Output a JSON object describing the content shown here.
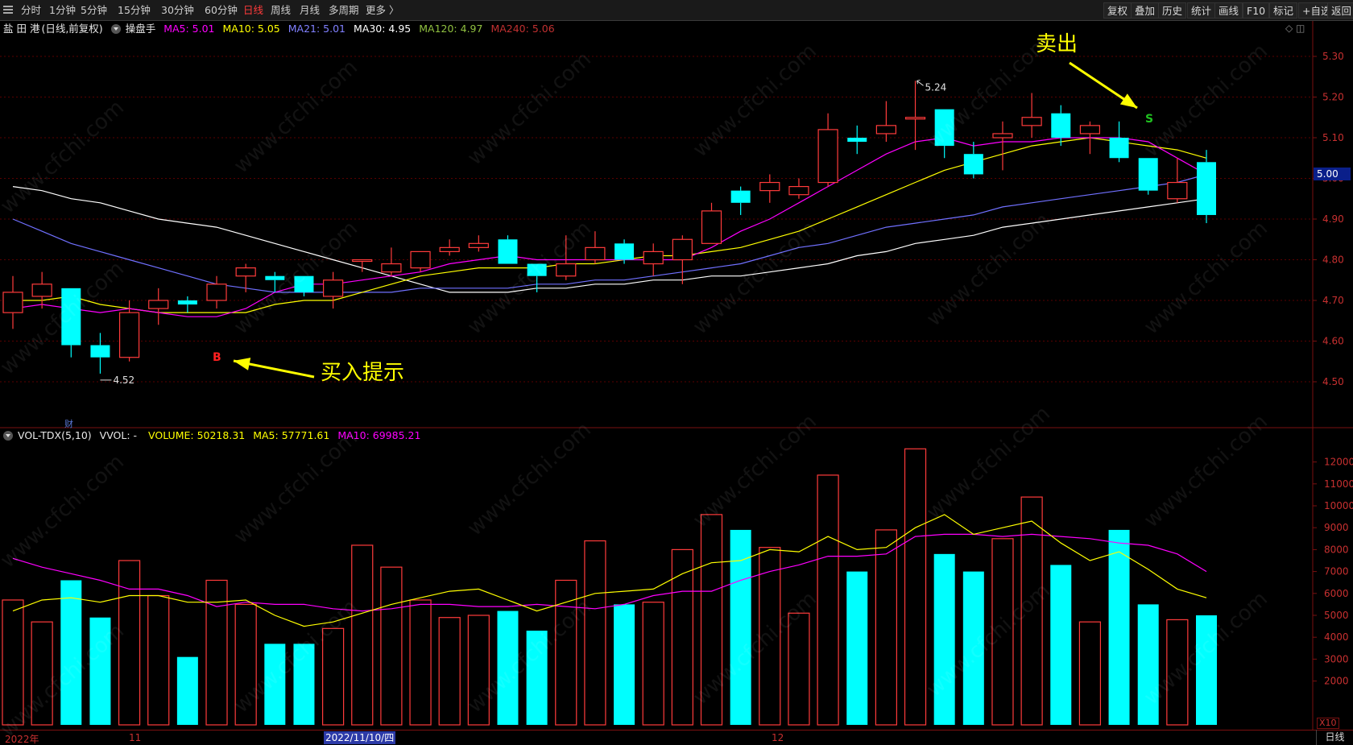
{
  "toolbar": {
    "periods": [
      "分时",
      "1分钟",
      "5分钟",
      "15分钟",
      "30分钟",
      "60分钟",
      "日线",
      "周线",
      "月线",
      "多周期",
      "更多 〉"
    ],
    "active_period": "日线",
    "right_buttons": [
      "复权",
      "叠加",
      "历史",
      "统计",
      "画线",
      "F10",
      "标记",
      "+自选",
      "返回"
    ]
  },
  "info": {
    "stock": "盐 田 港",
    "mode": "(日线,前复权)",
    "indicator": "操盘手",
    "ma5": "MA5: 5.01",
    "ma10": "MA10: 5.05",
    "ma21": "MA21: 5.01",
    "ma30": "MA30: 4.95",
    "ma120": "MA120: 4.97",
    "ma240": "MA240: 5.06"
  },
  "volume_info": {
    "title": "VOL-TDX(5,10)",
    "vvol": "VVOL: -",
    "volume": "VOLUME: 50218.31",
    "ma5": "MA5: 57771.61",
    "ma10": "MA10: 69985.21"
  },
  "annotations": {
    "sell_text": "卖出",
    "buy_text": "买入提示",
    "buy_mark": "B",
    "sell_mark": "S",
    "high_label": "5.24",
    "low_label": "4.52",
    "cai": "财"
  },
  "price_tag": "5.00",
  "x10": "X10",
  "period_button": "日线",
  "date_axis": {
    "labels": [
      "2022年",
      "11",
      "12"
    ],
    "selected": "2022/11/10/四"
  },
  "watermark": "www.cfchi.com",
  "colors": {
    "up": "#ff3b3b",
    "down": "#00ffff",
    "ma5": "#ff00ff",
    "ma10": "#ffff00",
    "ma21": "#7070ff",
    "ma30": "#ffffff",
    "ma120": "#90c040",
    "ma240": "#c03030",
    "annotation": "#ffff00"
  },
  "chart_data": {
    "type": "candlestick",
    "price_axis_ticks": [
      "5.30",
      "5.20",
      "5.10",
      "5.00",
      "4.90",
      "4.80",
      "4.70",
      "4.60",
      "4.50"
    ],
    "ylim": [
      4.43,
      5.36
    ],
    "volume_axis_ticks": [
      "12000",
      "11000",
      "10000",
      "9000",
      "8000",
      "7000",
      "6000",
      "5000",
      "4000",
      "3000",
      "2000"
    ],
    "volume_ylim": [
      0,
      12600
    ],
    "candles": [
      {
        "o": 4.67,
        "h": 4.76,
        "l": 4.63,
        "c": 4.72
      },
      {
        "o": 4.71,
        "h": 4.77,
        "l": 4.68,
        "c": 4.74
      },
      {
        "o": 4.73,
        "h": 4.73,
        "l": 4.56,
        "c": 4.59
      },
      {
        "o": 4.59,
        "h": 4.62,
        "l": 4.52,
        "c": 4.56
      },
      {
        "o": 4.56,
        "h": 4.7,
        "l": 4.55,
        "c": 4.67
      },
      {
        "o": 4.68,
        "h": 4.73,
        "l": 4.64,
        "c": 4.7
      },
      {
        "o": 4.7,
        "h": 4.71,
        "l": 4.67,
        "c": 4.69
      },
      {
        "o": 4.7,
        "h": 4.76,
        "l": 4.68,
        "c": 4.74
      },
      {
        "o": 4.76,
        "h": 4.79,
        "l": 4.72,
        "c": 4.78
      },
      {
        "o": 4.76,
        "h": 4.77,
        "l": 4.72,
        "c": 4.75
      },
      {
        "o": 4.76,
        "h": 4.76,
        "l": 4.71,
        "c": 4.72
      },
      {
        "o": 4.71,
        "h": 4.77,
        "l": 4.68,
        "c": 4.75
      },
      {
        "o": 4.8,
        "h": 4.8,
        "l": 4.77,
        "c": 4.8
      },
      {
        "o": 4.77,
        "h": 4.83,
        "l": 4.76,
        "c": 4.79
      },
      {
        "o": 4.78,
        "h": 4.82,
        "l": 4.77,
        "c": 4.82
      },
      {
        "o": 4.82,
        "h": 4.85,
        "l": 4.81,
        "c": 4.83
      },
      {
        "o": 4.83,
        "h": 4.86,
        "l": 4.82,
        "c": 4.84
      },
      {
        "o": 4.85,
        "h": 4.86,
        "l": 4.79,
        "c": 4.79
      },
      {
        "o": 4.79,
        "h": 4.79,
        "l": 4.72,
        "c": 4.76
      },
      {
        "o": 4.76,
        "h": 4.86,
        "l": 4.75,
        "c": 4.79
      },
      {
        "o": 4.8,
        "h": 4.87,
        "l": 4.79,
        "c": 4.83
      },
      {
        "o": 4.84,
        "h": 4.85,
        "l": 4.79,
        "c": 4.8
      },
      {
        "o": 4.79,
        "h": 4.84,
        "l": 4.76,
        "c": 4.82
      },
      {
        "o": 4.8,
        "h": 4.86,
        "l": 4.74,
        "c": 4.85
      },
      {
        "o": 4.84,
        "h": 4.94,
        "l": 4.84,
        "c": 4.92
      },
      {
        "o": 4.97,
        "h": 4.98,
        "l": 4.91,
        "c": 4.94
      },
      {
        "o": 4.97,
        "h": 5.01,
        "l": 4.94,
        "c": 4.99
      },
      {
        "o": 4.96,
        "h": 5.0,
        "l": 4.95,
        "c": 4.98
      },
      {
        "o": 4.99,
        "h": 5.16,
        "l": 4.98,
        "c": 5.12
      },
      {
        "o": 5.1,
        "h": 5.13,
        "l": 5.06,
        "c": 5.09
      },
      {
        "o": 5.11,
        "h": 5.19,
        "l": 5.09,
        "c": 5.13
      },
      {
        "o": 5.15,
        "h": 5.24,
        "l": 5.07,
        "c": 5.15
      },
      {
        "o": 5.17,
        "h": 5.17,
        "l": 5.05,
        "c": 5.08
      },
      {
        "o": 5.06,
        "h": 5.09,
        "l": 5.0,
        "c": 5.01
      },
      {
        "o": 5.1,
        "h": 5.14,
        "l": 5.02,
        "c": 5.11
      },
      {
        "o": 5.13,
        "h": 5.21,
        "l": 5.1,
        "c": 5.15
      },
      {
        "o": 5.16,
        "h": 5.18,
        "l": 5.08,
        "c": 5.1
      },
      {
        "o": 5.11,
        "h": 5.14,
        "l": 5.06,
        "c": 5.13
      },
      {
        "o": 5.1,
        "h": 5.14,
        "l": 5.04,
        "c": 5.05
      },
      {
        "o": 5.05,
        "h": 5.05,
        "l": 4.96,
        "c": 4.97
      },
      {
        "o": 4.95,
        "h": 5.05,
        "l": 4.94,
        "c": 4.99
      },
      {
        "o": 5.04,
        "h": 5.07,
        "l": 4.89,
        "c": 4.91
      }
    ],
    "ma5": [
      4.68,
      4.69,
      4.68,
      4.67,
      4.68,
      4.67,
      4.66,
      4.66,
      4.68,
      4.72,
      4.74,
      4.74,
      4.75,
      4.76,
      4.77,
      4.79,
      4.8,
      4.81,
      4.8,
      4.8,
      4.8,
      4.8,
      4.8,
      4.8,
      4.83,
      4.87,
      4.9,
      4.94,
      4.98,
      5.02,
      5.06,
      5.09,
      5.1,
      5.08,
      5.09,
      5.09,
      5.1,
      5.1,
      5.1,
      5.09,
      5.05,
      5.01
    ],
    "ma10": [
      4.7,
      4.7,
      4.71,
      4.69,
      4.68,
      4.67,
      4.67,
      4.67,
      4.67,
      4.69,
      4.7,
      4.7,
      4.72,
      4.74,
      4.76,
      4.77,
      4.78,
      4.78,
      4.78,
      4.79,
      4.79,
      4.8,
      4.81,
      4.81,
      4.82,
      4.83,
      4.85,
      4.87,
      4.9,
      4.93,
      4.96,
      4.99,
      5.02,
      5.04,
      5.06,
      5.08,
      5.09,
      5.1,
      5.09,
      5.08,
      5.07,
      5.05
    ],
    "ma21": [
      4.9,
      4.87,
      4.84,
      4.82,
      4.8,
      4.78,
      4.76,
      4.74,
      4.73,
      4.72,
      4.72,
      4.72,
      4.72,
      4.72,
      4.73,
      4.73,
      4.73,
      4.73,
      4.74,
      4.74,
      4.75,
      4.75,
      4.76,
      4.77,
      4.78,
      4.79,
      4.81,
      4.83,
      4.84,
      4.86,
      4.88,
      4.89,
      4.9,
      4.91,
      4.93,
      4.94,
      4.95,
      4.96,
      4.97,
      4.98,
      4.99,
      5.01
    ],
    "ma30": [
      4.98,
      4.97,
      4.95,
      4.94,
      4.92,
      4.9,
      4.89,
      4.88,
      4.86,
      4.84,
      4.82,
      4.8,
      4.78,
      4.76,
      4.74,
      4.72,
      4.72,
      4.72,
      4.73,
      4.73,
      4.74,
      4.74,
      4.75,
      4.75,
      4.76,
      4.76,
      4.77,
      4.78,
      4.79,
      4.81,
      4.82,
      4.84,
      4.85,
      4.86,
      4.88,
      4.89,
      4.9,
      4.91,
      4.92,
      4.93,
      4.94,
      4.95
    ],
    "volume": [
      5700,
      4700,
      6600,
      4900,
      7500,
      5900,
      3100,
      6600,
      5500,
      3700,
      3700,
      4400,
      8200,
      7200,
      5700,
      4900,
      5000,
      5200,
      4300,
      6600,
      8400,
      5500,
      5600,
      8000,
      9600,
      8900,
      8100,
      5100,
      11400,
      7000,
      8900,
      12600,
      7800,
      7000,
      8500,
      10400,
      7300,
      4700,
      8900,
      5500,
      4800,
      5000
    ],
    "vol_ma5": [
      5200,
      5700,
      5800,
      5600,
      5900,
      5900,
      5600,
      5600,
      5700,
      5000,
      4500,
      4700,
      5100,
      5500,
      5800,
      6100,
      6200,
      5700,
      5200,
      5600,
      6000,
      6100,
      6200,
      6900,
      7400,
      7500,
      8000,
      7900,
      8600,
      8000,
      8100,
      9000,
      9600,
      8700,
      9000,
      9300,
      8300,
      7500,
      7900,
      7100,
      6200,
      5800
    ],
    "vol_ma10": [
      7600,
      7200,
      6900,
      6600,
      6200,
      6200,
      5900,
      5400,
      5600,
      5500,
      5500,
      5300,
      5200,
      5300,
      5500,
      5500,
      5400,
      5400,
      5500,
      5400,
      5300,
      5500,
      5900,
      6100,
      6100,
      6600,
      7000,
      7300,
      7700,
      7700,
      7800,
      8600,
      8700,
      8700,
      8600,
      8700,
      8600,
      8500,
      8300,
      8200,
      7800,
      7000
    ]
  }
}
